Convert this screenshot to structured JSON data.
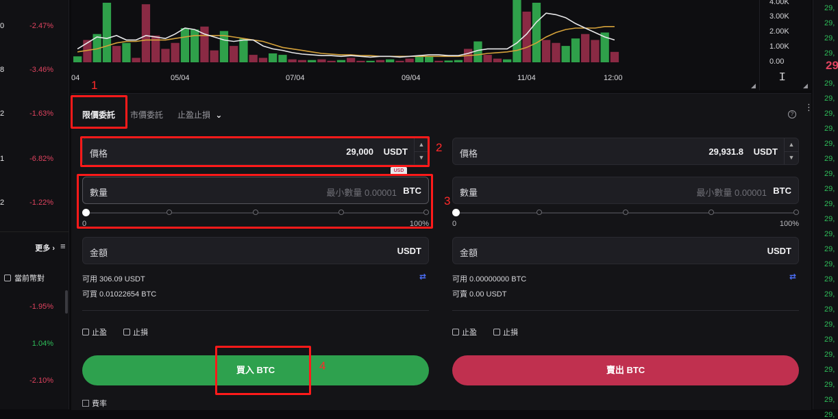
{
  "left_list": {
    "rows": [
      {
        "frag": "0",
        "change": "-2.47%",
        "dir": "down"
      },
      {
        "frag": "8",
        "change": "-3.46%",
        "dir": "down"
      },
      {
        "frag": "2",
        "change": "-1.63%",
        "dir": "down"
      },
      {
        "frag": "1",
        "change": "-6.82%",
        "dir": "down"
      },
      {
        "frag": "2",
        "change": "-1.22%",
        "dir": "down"
      }
    ],
    "more_label": "更多 ›",
    "menu_icon": "≡",
    "current_pair_label": "當前幣對",
    "rows2": [
      {
        "change": "-1.95%",
        "dir": "down"
      },
      {
        "change": "1.04%",
        "dir": "up"
      },
      {
        "change": "-2.10%",
        "dir": "down"
      }
    ]
  },
  "chart": {
    "y_ticks": [
      "4.00K",
      "3.00K",
      "2.00K",
      "1.00K",
      "0.00"
    ],
    "x_ticks": [
      "04",
      "05/04",
      "07/04",
      "09/04",
      "11/04",
      "12:00"
    ],
    "up_color": "#2fa04a",
    "down_color": "#8a2a44",
    "ma1_color": "#e8e8ea",
    "ma2_color": "#d6a23a"
  },
  "chart_data": {
    "type": "bar",
    "ylim": [
      0,
      4000
    ],
    "series": [
      {
        "values": [
          400,
          1500,
          1900,
          4000,
          1100,
          1300,
          300,
          3900,
          1800,
          900,
          1300,
          2300,
          2200,
          2400,
          800,
          2100,
          1100,
          1600,
          500,
          300,
          600,
          500,
          200,
          150,
          150,
          200,
          100,
          150,
          300,
          100,
          100,
          150,
          200,
          100,
          250,
          400,
          400,
          100,
          120,
          150,
          900,
          1400,
          500,
          250,
          200,
          4200,
          3400,
          4000,
          1500,
          1300,
          1100,
          1600,
          1900,
          1500,
          2000,
          700
        ]
      },
      {
        "values": [
          900,
          1300,
          1700,
          1600,
          1800,
          1500,
          1500,
          1800,
          1700,
          1600,
          1900,
          2300,
          2200,
          1900,
          1700,
          1500,
          1400,
          1500,
          1500,
          1100,
          900,
          800,
          650,
          550,
          500,
          450,
          450,
          400,
          450,
          400,
          350,
          400,
          400,
          350,
          400,
          450,
          500,
          500,
          450,
          450,
          600,
          800,
          900,
          900,
          900,
          1300,
          1900,
          2700,
          3300,
          3200,
          3000,
          2600,
          2300,
          2000,
          1700,
          1500
        ]
      },
      {
        "values": [
          700,
          800,
          900,
          1100,
          1300,
          1400,
          1400,
          1500,
          1500,
          1500,
          1600,
          1700,
          1800,
          1800,
          1800,
          1800,
          1700,
          1600,
          1500,
          1400,
          1200,
          1000,
          900,
          800,
          700,
          600,
          550,
          500,
          500,
          450,
          450,
          400,
          400,
          400,
          400,
          400,
          400,
          400,
          400,
          400,
          450,
          500,
          600,
          650,
          700,
          800,
          1000,
          1300,
          1700,
          2000,
          2200,
          2300,
          2300,
          2300,
          2400,
          2400
        ]
      }
    ]
  },
  "order_panel": {
    "tabs": [
      {
        "label": "限價委託",
        "active": true
      },
      {
        "label": "市價委託",
        "active": false
      },
      {
        "label": "止盈止損",
        "active": false
      }
    ],
    "tab_dropdown_icon": "⌄",
    "help_icon": "?",
    "menu_icon": "⋮",
    "buy": {
      "price_label": "價格",
      "price_value": "29,000",
      "price_unit": "USDT",
      "qty_label": "數量",
      "qty_placeholder": "最小數量 0.00001",
      "qty_unit": "BTC",
      "slider_min": "0",
      "slider_max": "100%",
      "slider_fraction": 0,
      "amount_label": "金額",
      "amount_unit": "USDT",
      "available": "可用 306.09 USDT",
      "buyable": "可買 0.01022654 BTC",
      "tp_label": "止盈",
      "sl_label": "止損",
      "button_label": "買入 BTC"
    },
    "sell": {
      "price_label": "價格",
      "price_value": "29,931.8",
      "price_unit": "USDT",
      "qty_label": "數量",
      "qty_placeholder": "最小數量 0.00001",
      "qty_unit": "BTC",
      "slider_min": "0",
      "slider_max": "100%",
      "slider_fraction": 0,
      "amount_label": "金額",
      "amount_unit": "USDT",
      "available": "可用 0.00000000 BTC",
      "sellable": "可賣 0.00 USDT",
      "tp_label": "止盈",
      "sl_label": "止損",
      "button_label": "賣出 BTC"
    },
    "swap_icon": "⇄",
    "fee_label": "費率",
    "usd_badge": "USD"
  },
  "order_book_strip": {
    "big_price": "29",
    "rows": [
      "29,",
      "29,",
      "29,",
      "29,",
      "29,",
      "29,",
      "29,",
      "29,",
      "29,",
      "29,",
      "29,",
      "29,",
      "29,",
      "29,",
      "29,",
      "29,",
      "29,",
      "29,",
      "29,",
      "29,",
      "29,",
      "29,",
      "29,",
      "29,",
      "29,",
      "29,",
      "29,"
    ]
  },
  "annotations": {
    "labels": [
      "1",
      "2",
      "3",
      "4"
    ],
    "color": "#ff1a1a"
  },
  "colors": {
    "buy": "#2ea14e",
    "sell": "#c0304f",
    "background": "#0b0b0d",
    "panel": "#141417"
  }
}
